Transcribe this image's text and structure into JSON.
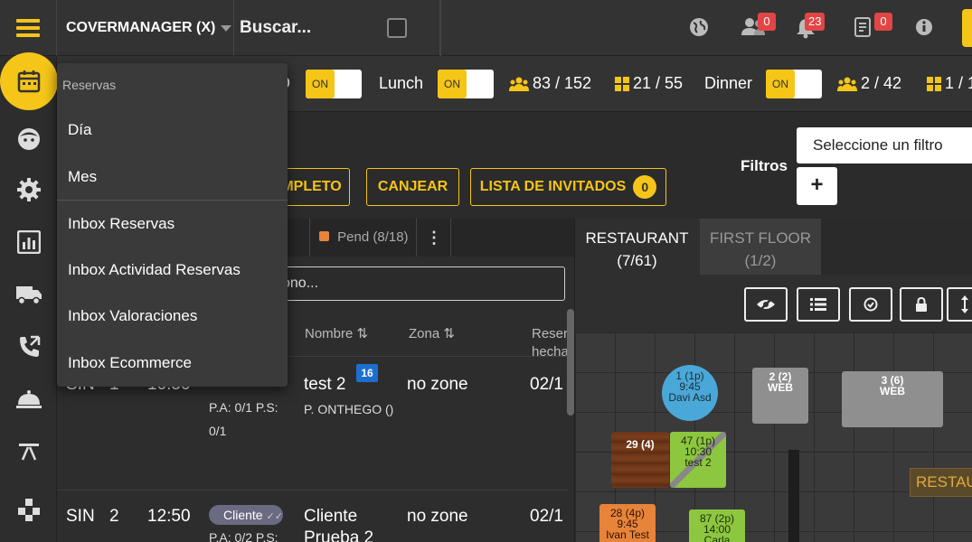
{
  "topbar": {
    "brand": "COVERMANAGER (X)",
    "search_label": "Buscar...",
    "badges": {
      "users": "0",
      "bell": "23",
      "notes": "0"
    }
  },
  "services": {
    "toggle_label": "ON",
    "partial_label": "D",
    "lunch_label": "Lunch",
    "lunch_people": "83 / 152",
    "lunch_tables": "21 / 55",
    "dinner_label": "Dinner",
    "dinner_people": "2 / 42",
    "dinner_tables": "1 / 1"
  },
  "actions": {
    "completo_label": "MPLETO",
    "canjear_label": "CANJEAR",
    "invitados_label": "LISTA DE INVITADOS",
    "invitados_count": "0",
    "filtros_label": "Filtros",
    "filter_placeholder": "Seleccione un filtro",
    "plus_label": "+"
  },
  "list": {
    "tab_partial": ")",
    "tab_pend": "Pend (8/18)",
    "search_text": "ono...",
    "columns": {
      "nombre": "Nombre",
      "zona": "Zona",
      "reserva_line1": "Reser",
      "reserva_line2": "hecha"
    },
    "rows": [
      {
        "status": "SIN",
        "num": "1",
        "time": "10:50",
        "pa": "P.A: 0/1",
        "ps": "P.S:",
        "ps_value": "0/1",
        "name": "test 2",
        "tag": "16",
        "sub": "P. ONTHEGO ()",
        "zone": "no zone",
        "date": "02/1"
      },
      {
        "status": "SIN",
        "num": "2",
        "time": "12:50",
        "pill": "Cliente",
        "pa": "P.A: 0/2",
        "ps": "P.S:",
        "name": "Cliente",
        "name2": "Prueba 2",
        "zone": "no zone",
        "date": "02/1"
      }
    ]
  },
  "plan": {
    "tab_restaurant": "RESTAURANT",
    "tab_restaurant_count": "(7/61)",
    "tab_first_floor": "FIRST FLOOR",
    "tab_first_floor_count": "(1/2)",
    "restau_label": "RESTAU",
    "tables": [
      {
        "id": "1",
        "l1": "1 (1p)",
        "l2": "9:45",
        "l3": "Davi Asd"
      },
      {
        "id": "2",
        "l1": "2 (2)",
        "l2": "WEB"
      },
      {
        "id": "3",
        "l1": "3 (6)",
        "l2": "WEB"
      },
      {
        "id": "29",
        "l1": "29 (4)"
      },
      {
        "id": "47",
        "l1": "47 (1p)",
        "l2": "10:30",
        "l3": "test 2"
      },
      {
        "id": "28",
        "l1": "28 (4p)",
        "l2": "9:45",
        "l3": "Ivan Test"
      },
      {
        "id": "87",
        "l1": "87 (2p)",
        "l2": "14:00",
        "l3": "Carla"
      }
    ]
  },
  "menu": {
    "header": "Reservas",
    "items": [
      "Día",
      "Mes",
      "Inbox Reservas",
      "Inbox Actividad Reservas",
      "Inbox Valoraciones",
      "Inbox Ecommerce"
    ]
  },
  "colors": {
    "accent": "#f5c518",
    "badge": "#e24545",
    "table_blue": "#4aa8d8",
    "table_green": "#8dc63f",
    "table_orange": "#e8833a"
  }
}
